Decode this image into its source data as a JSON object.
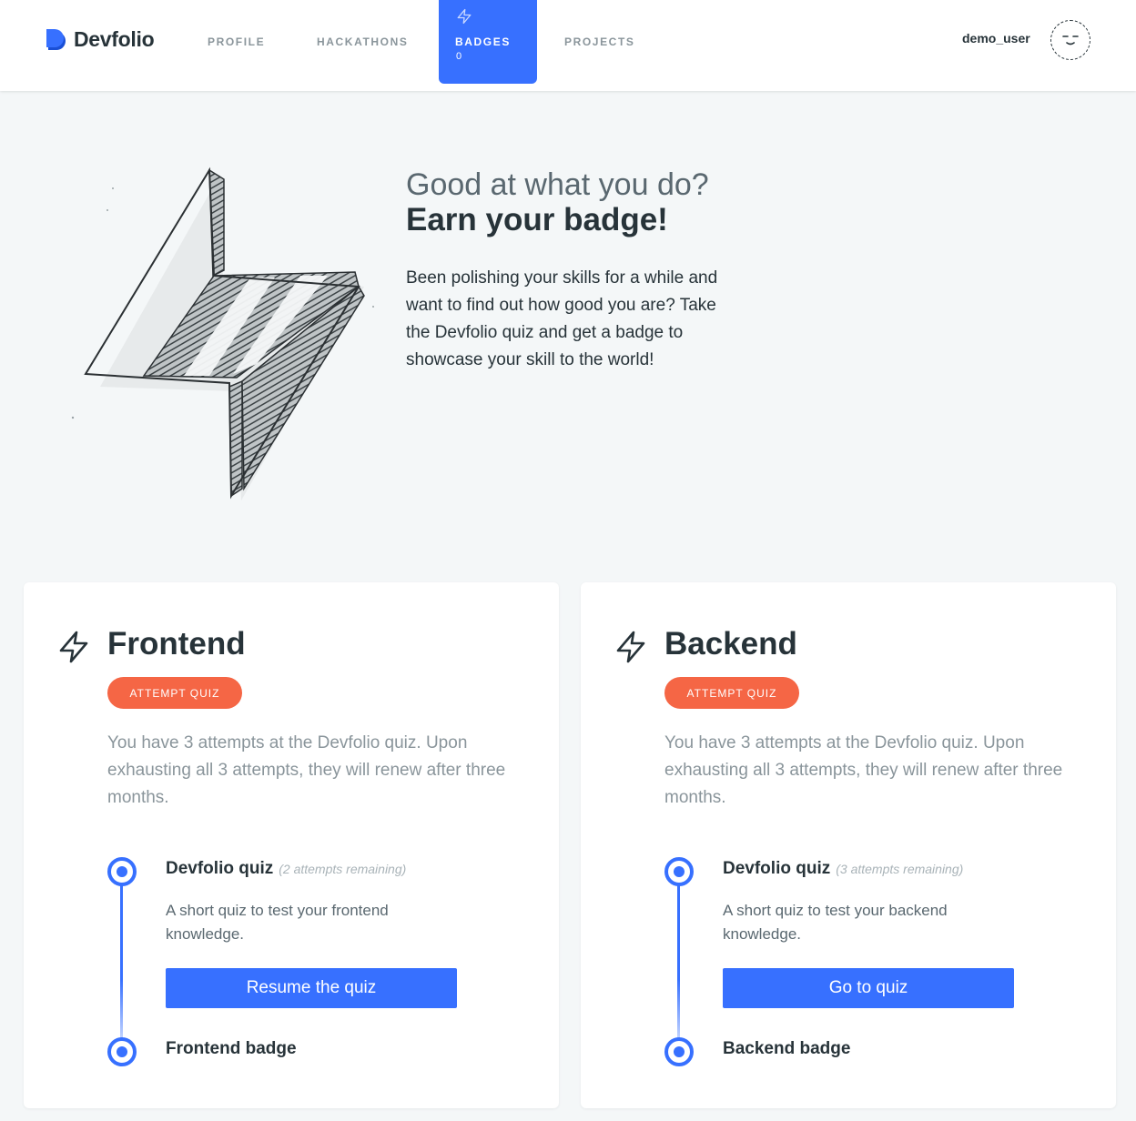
{
  "header": {
    "brand": "Devfolio",
    "nav": {
      "profile": "PROFILE",
      "hackathons": "HACKATHONS",
      "badges": "BADGES",
      "badges_count": "0",
      "projects": "PROJECTS"
    },
    "user": "demo_user"
  },
  "hero": {
    "subtitle": "Good at what you do?",
    "title": "Earn your badge!",
    "description": "Been polishing your skills for a while and want to find out how good you are? Take the Devfolio quiz and get a badge to showcase your skill to the world!"
  },
  "cards": [
    {
      "title": "Frontend",
      "attempt_label": "ATTEMPT QUIZ",
      "description": "You have 3 attempts at the Devfolio quiz. Upon exhausting all 3 attempts, they will renew after three months.",
      "quiz_name": "Devfolio quiz",
      "quiz_remaining": "(2 attempts remaining)",
      "quiz_description": "A short quiz to test your frontend knowledge.",
      "quiz_button": "Resume the quiz",
      "badge_name": "Frontend badge"
    },
    {
      "title": "Backend",
      "attempt_label": "ATTEMPT QUIZ",
      "description": "You have 3 attempts at the Devfolio quiz. Upon exhausting all 3 attempts, they will renew after three months.",
      "quiz_name": "Devfolio quiz",
      "quiz_remaining": "(3 attempts remaining)",
      "quiz_description": "A short quiz to test your backend knowledge.",
      "quiz_button": "Go to quiz",
      "badge_name": "Backend badge"
    }
  ],
  "colors": {
    "primary": "#3770ff",
    "accent": "#f56645",
    "text": "#273339",
    "muted": "#8a959b",
    "background": "#f4f7f8"
  },
  "icons": {
    "brand": "devfolio-logo-icon",
    "nav_badges": "bolt-icon",
    "avatar": "smiley-face-icon",
    "card": "bolt-icon"
  }
}
